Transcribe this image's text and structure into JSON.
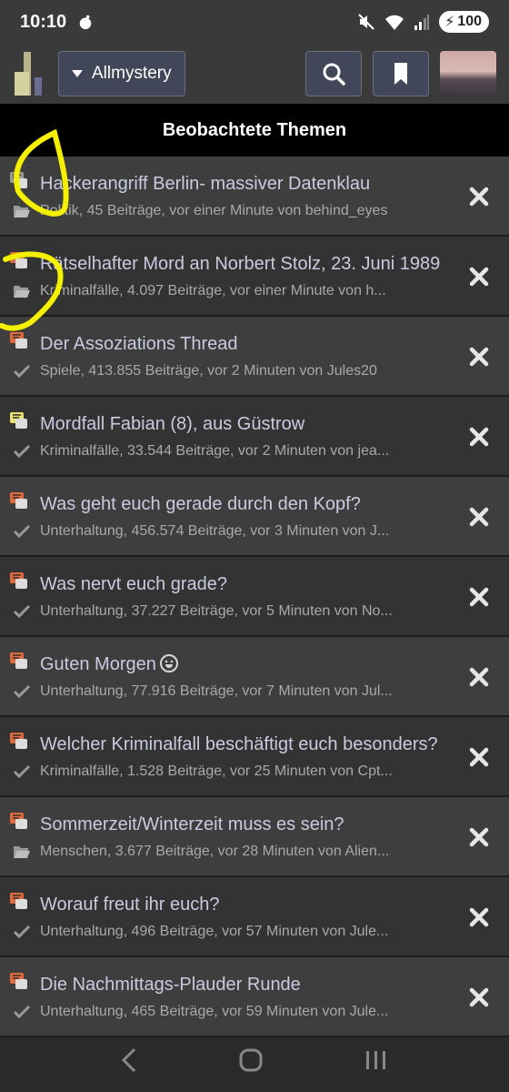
{
  "status": {
    "time": "10:10",
    "battery": "100"
  },
  "toolbar": {
    "forum_label": "Allmystery"
  },
  "section": {
    "title": "Beobachtete Themen"
  },
  "threads": [
    {
      "title": "Hackerangriff Berlin- massiver Datenklau",
      "meta": "Politik, 45 Beiträge, vor einer Minute von behind_eyes",
      "bubble": "#9a9a9a",
      "state": "folder"
    },
    {
      "title": "Rätselhafter Mord an Norbert Stolz, 23. Juni 1989",
      "meta": "Kriminalfälle, 4.097 Beiträge, vor einer Minute von h...",
      "bubble": "#e06a3c",
      "state": "folder"
    },
    {
      "title": "Der Assoziations Thread",
      "meta": "Spiele, 413.855 Beiträge, vor 2 Minuten von Jules20",
      "bubble": "#e06a3c",
      "state": "check"
    },
    {
      "title": "Mordfall Fabian (8), aus Güstrow",
      "meta": "Kriminalfälle, 33.544 Beiträge, vor 2 Minuten von jea...",
      "bubble": "#e8e070",
      "state": "check"
    },
    {
      "title": "Was geht euch gerade durch den Kopf?",
      "meta": "Unterhaltung, 456.574 Beiträge, vor 3 Minuten von J...",
      "bubble": "#e06a3c",
      "state": "check"
    },
    {
      "title": "Was nervt euch grade?",
      "meta": "Unterhaltung, 37.227 Beiträge, vor 5 Minuten von No...",
      "bubble": "#e06a3c",
      "state": "check"
    },
    {
      "title": "Guten Morgen",
      "meta": "Unterhaltung, 77.916 Beiträge, vor 7 Minuten von Jul...",
      "bubble": "#e06a3c",
      "state": "check",
      "emoji": true
    },
    {
      "title": "Welcher Kriminalfall beschäftigt euch besonders?",
      "meta": "Kriminalfälle, 1.528 Beiträge, vor 25 Minuten von Cpt...",
      "bubble": "#e06a3c",
      "state": "check"
    },
    {
      "title": "Sommerzeit/Winterzeit muss es sein?",
      "meta": "Menschen, 3.677 Beiträge, vor 28 Minuten von Alien...",
      "bubble": "#e06a3c",
      "state": "folder"
    },
    {
      "title": "Worauf freut ihr euch?",
      "meta": "Unterhaltung, 496 Beiträge, vor 57 Minuten von Jule...",
      "bubble": "#e06a3c",
      "state": "check"
    },
    {
      "title": "Die Nachmittags-Plauder Runde",
      "meta": "Unterhaltung, 465 Beiträge, vor 59 Minuten von Jule...",
      "bubble": "#e06a3c",
      "state": "check"
    }
  ],
  "colors": {
    "accent": "#414658",
    "header": "#000000",
    "highlight": "#f5f000"
  }
}
